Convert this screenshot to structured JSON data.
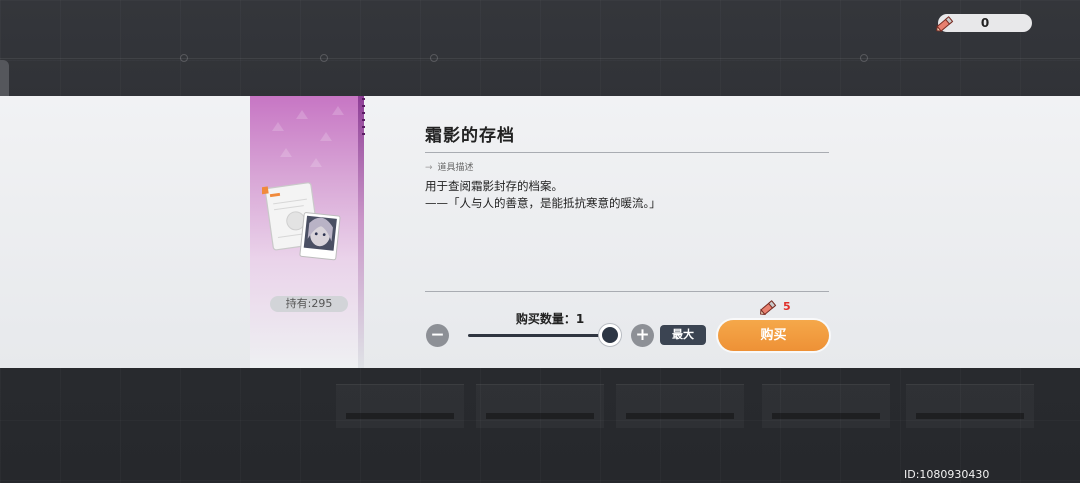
{
  "currency": {
    "icon": "pen-icon",
    "amount": "0"
  },
  "item": {
    "name": "霜影的存档",
    "owned_label": "持有:295",
    "section_label": "道具描述",
    "description_line1": "用于查阅霜影封存的档案。",
    "description_line2": "——「人与人的善意，是能抵抗寒意的暖流。」",
    "rarity_color": "#c776c4"
  },
  "purchase": {
    "quantity_label": "购买数量：1",
    "quantity": 1,
    "slider_fraction": 1.0,
    "minus_symbol": "−",
    "plus_symbol": "+",
    "max_label": "最大",
    "cost_icon": "pen-icon",
    "cost_value": "5",
    "buy_label": "购买",
    "buy_color": "#f09a3c"
  },
  "footer": {
    "uid": "ID:1080930430"
  }
}
